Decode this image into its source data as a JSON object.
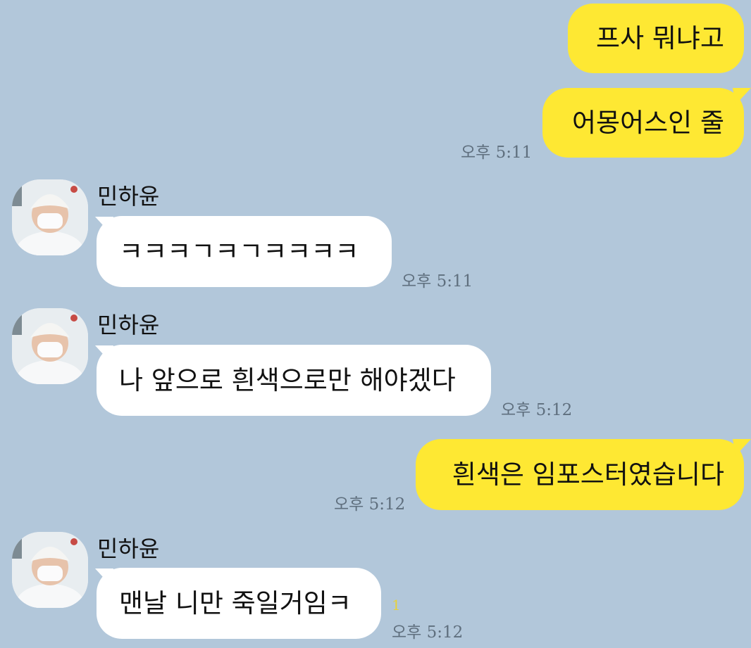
{
  "messages": [
    {
      "side": "me",
      "text": "프사 뭐냐고"
    },
    {
      "side": "me",
      "text": "어몽어스인 줄",
      "time": "오후 5:11"
    },
    {
      "side": "them",
      "sender": "민하윤",
      "text": "ㅋㅋㅋㄱㅋㄱㅋㅋㅋㅋ",
      "time": "오후 5:11"
    },
    {
      "side": "them",
      "sender": "민하윤",
      "text": "나 앞으로 흰색으로만 해야겠다",
      "time": "오후 5:12"
    },
    {
      "side": "me",
      "text": "흰색은 임포스터였습니다",
      "time": "오후 5:12"
    },
    {
      "side": "them",
      "sender": "민하윤",
      "text": "맨날 니만 죽일거임ㅋ",
      "time": "오후 5:12",
      "unread": "1"
    }
  ],
  "colors": {
    "background": "#b2c7da",
    "my_bubble": "#fee833",
    "their_bubble": "#ffffff",
    "timestamp": "#5f6f7e",
    "unread": "#e7d23c"
  },
  "icons": {
    "avatar": "profile-photo-person-white-beanie-mask"
  }
}
